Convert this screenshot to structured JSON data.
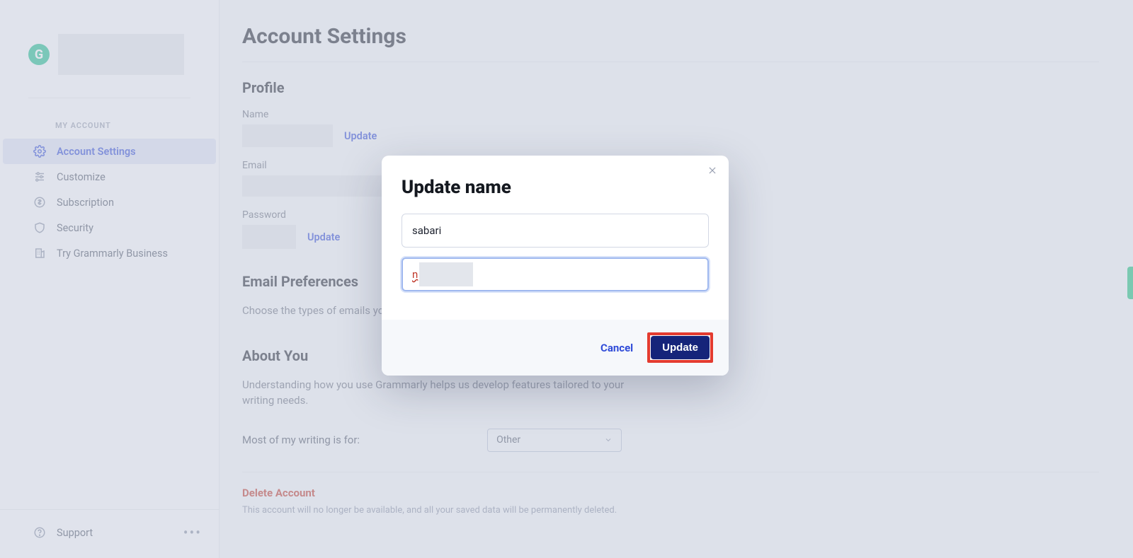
{
  "brand": {
    "logo_letter": "G"
  },
  "sidebar": {
    "section_label": "MY ACCOUNT",
    "items": [
      {
        "label": "Account Settings"
      },
      {
        "label": "Customize"
      },
      {
        "label": "Subscription"
      },
      {
        "label": "Security"
      },
      {
        "label": "Try Grammarly Business"
      }
    ],
    "support_label": "Support"
  },
  "page": {
    "title": "Account Settings",
    "profile": {
      "heading": "Profile",
      "name_label": "Name",
      "name_update": "Update",
      "email_label": "Email",
      "password_label": "Password",
      "password_update": "Update"
    },
    "email_prefs": {
      "heading": "Email Preferences",
      "desc_partial": "Choose the types of emails you"
    },
    "about_you": {
      "heading": "About You",
      "desc": "Understanding how you use Grammarly helps us develop features tailored to your writing needs.",
      "writing_label": "Most of my writing is for:",
      "writing_value": "Other"
    },
    "delete": {
      "heading": "Delete Account",
      "desc": "This account will no longer be available, and all your saved data will be permanently deleted."
    }
  },
  "modal": {
    "title": "Update name",
    "first_name_value": "sabari",
    "last_name_prefix": "n",
    "cancel_label": "Cancel",
    "update_label": "Update"
  }
}
